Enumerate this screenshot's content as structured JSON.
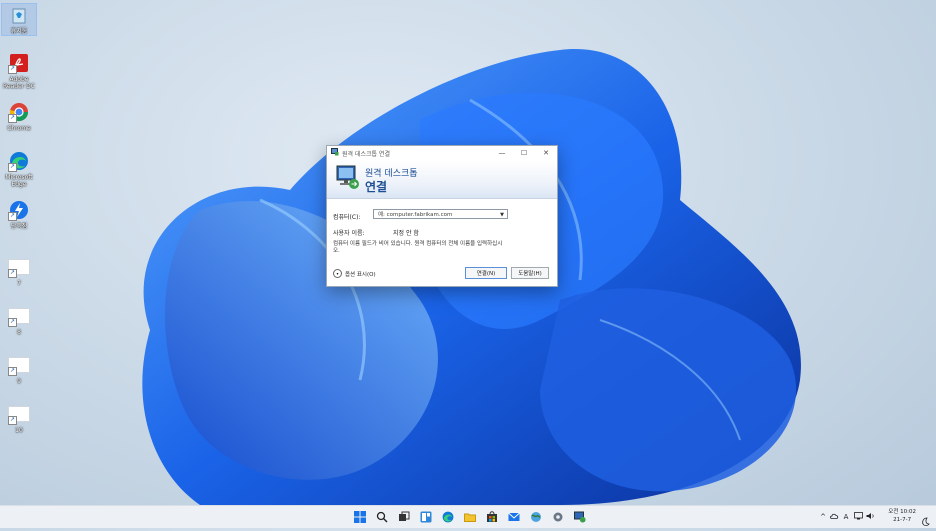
{
  "desktop": {
    "icons": [
      {
        "label": "휴지통",
        "icon": "recycle-bin-icon"
      },
      {
        "label": "Adobe Reader DC",
        "icon": "adobe-reader-icon"
      },
      {
        "label": "Chrome",
        "icon": "chrome-icon"
      },
      {
        "label": "Microsoft Edge",
        "icon": "edge-icon"
      },
      {
        "label": "단축점",
        "icon": "shortcut-app-icon"
      },
      {
        "label": "7",
        "icon": "file-icon"
      },
      {
        "label": "8",
        "icon": "file-icon"
      },
      {
        "label": "9",
        "icon": "file-icon"
      },
      {
        "label": "10",
        "icon": "file-icon"
      }
    ]
  },
  "dialog": {
    "title": "원격 데스크톱 연결",
    "banner_line1": "원격 데스크톱",
    "banner_line2": "연결",
    "computer_label": "컴퓨터(C):",
    "computer_value": "예: computer.fabrikam.com",
    "username_label": "사용자 이름:",
    "username_value": "지정 안 함",
    "note": "컴퓨터 이름 필드가 비어 있습니다. 원격 컴퓨터의 전체 이름을 입력하십시오.",
    "options_label": "옵션 표시(O)",
    "connect_label": "연결(N)",
    "help_label": "도움말(H)",
    "minimize": "—",
    "maximize": "☐",
    "close": "✕"
  },
  "taskbar": {
    "icons": [
      "start-icon",
      "search-icon",
      "task-view-icon",
      "widgets-icon",
      "edge-icon",
      "file-explorer-icon",
      "store-icon",
      "mail-icon",
      "network-globe-icon",
      "settings-icon",
      "remote-desktop-icon"
    ],
    "tray": {
      "chevron": "^",
      "ime": "A",
      "time_line1": "오전 10:02",
      "time_line2": "21-7-7"
    }
  },
  "colors": {
    "accent": "#1d4f93",
    "wallpaper_blue": "#1565e0"
  }
}
